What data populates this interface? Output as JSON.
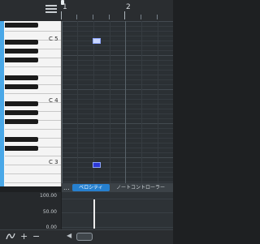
{
  "keyboard": {
    "octave_labels": [
      "C 5",
      "C 4",
      "C 3"
    ]
  },
  "ruler": {
    "bar_numbers": [
      "1",
      "2"
    ]
  },
  "editor_tabs": {
    "more": "...",
    "velocity": "ベロシティ",
    "note_controller": "ノートコントローラー"
  },
  "velocity_scale": [
    "100.00",
    "50.00",
    "0.00"
  ],
  "icons": {
    "menu": "hamburger-icon",
    "curve": "curve-icon",
    "add": "plus-icon",
    "remove": "minus-icon",
    "scroll_left": "scroll-left-icon"
  },
  "colors": {
    "selection": "#4aa8e8",
    "tab_active": "#2680cf",
    "note_light": "#c8d6ff",
    "note_dark": "#2c37d6"
  }
}
